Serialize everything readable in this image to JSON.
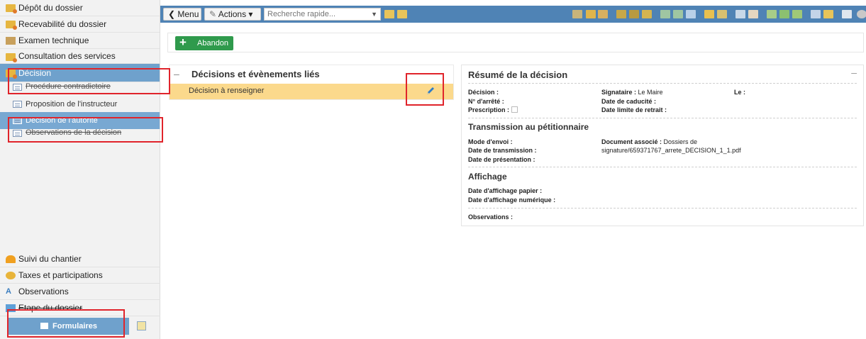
{
  "sidebar": {
    "items": [
      {
        "label": "Dépôt du dossier"
      },
      {
        "label": "Recevabilité du dossier"
      },
      {
        "label": "Examen technique"
      },
      {
        "label": "Consultation des services"
      },
      {
        "label": "Décision"
      }
    ],
    "subitems": [
      {
        "label": "Procédure contradictoire"
      },
      {
        "label": "Proposition de l'instructeur"
      },
      {
        "label": "Décision de l'autorité"
      },
      {
        "label": "Observations de la décision"
      }
    ],
    "bottom_items": [
      {
        "label": "Suivi du chantier"
      },
      {
        "label": "Taxes et participations"
      },
      {
        "label": "Observations"
      },
      {
        "label": "Etape du dossier"
      }
    ],
    "formulaires_label": "Formulaires"
  },
  "toolbar": {
    "menu_label": "Menu",
    "actions_label": "Actions",
    "search_placeholder": "Recherche rapide..."
  },
  "action_bar": {
    "abandon_label": "Abandon"
  },
  "decisions": {
    "title": "Décisions et évènements liés",
    "row_label": "Décision à renseigner"
  },
  "summary": {
    "title": "Résumé de la décision",
    "decision_label": "Décision :",
    "signataire_label": "Signataire :",
    "signataire_value": "Le Maire",
    "le_label": "Le :",
    "arrete_label": "N° d'arrêté :",
    "caducite_label": "Date de caducité :",
    "prescription_label": "Prescription :",
    "retrait_label": "Date limite de retrait :",
    "transmission_title": "Transmission au pétitionnaire",
    "mode_envoi_label": "Mode d'envoi :",
    "document_label": "Document associé :",
    "document_value_1": "Dossiers de",
    "document_value_2": "signature/659371767_arrete_DECISION_1_1.pdf",
    "date_transmission_label": "Date de transmission :",
    "date_presentation_label": "Date de présentation :",
    "affichage_title": "Affichage",
    "affichage_papier_label": "Date d'affichage papier :",
    "affichage_numerique_label": "Date d'affichage numérique :",
    "observations_label": "Observations :"
  }
}
